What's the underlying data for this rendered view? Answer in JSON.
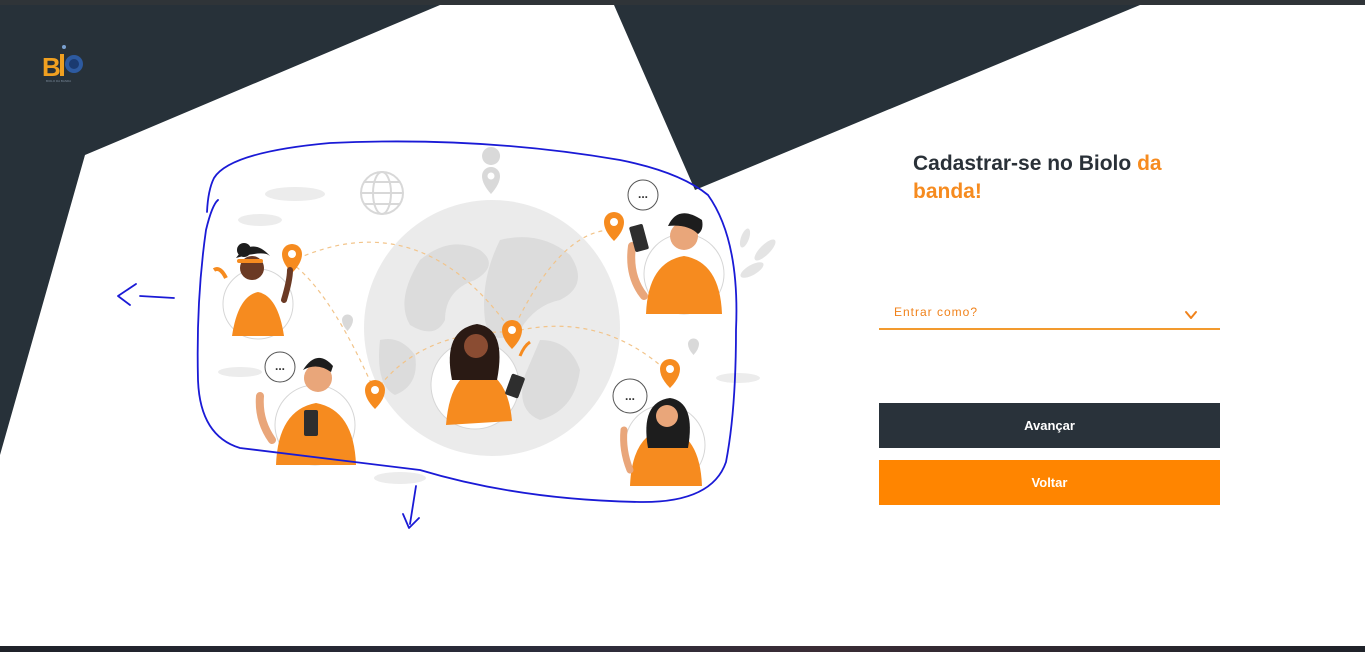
{
  "brand": {
    "logo_text": "BIOLO DA BANDA"
  },
  "signup": {
    "title_main": "Cadastrar-se no Biolo ",
    "title_accent": "da banda!",
    "role_select": {
      "placeholder": "Entrar como?"
    },
    "next_button": "Avançar",
    "back_button": "Voltar"
  },
  "illustration": {
    "speech_bubble_text": "..."
  },
  "colors": {
    "dark": "#29323a",
    "accent": "#ff8500",
    "annotation": "#1a1ad6"
  }
}
